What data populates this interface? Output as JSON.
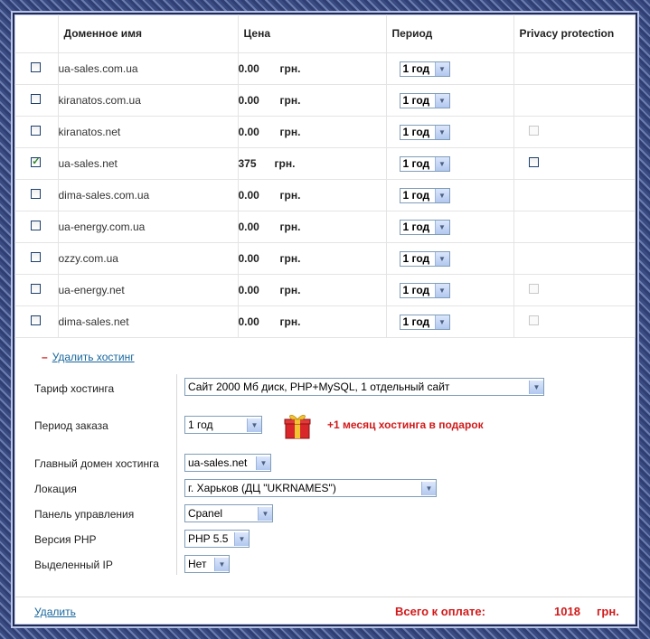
{
  "table": {
    "headers": {
      "domain": "Доменное имя",
      "price": "Цена",
      "period": "Период",
      "privacy": "Privacy protection"
    },
    "rows": [
      {
        "checked": false,
        "domain": "ua-sales.com.ua",
        "price": "0.00",
        "currency": "грн.",
        "period": "1 год",
        "privacy": "none"
      },
      {
        "checked": false,
        "domain": "kiranatos.com.ua",
        "price": "0.00",
        "currency": "грн.",
        "period": "1 год",
        "privacy": "none"
      },
      {
        "checked": false,
        "domain": "kiranatos.net",
        "price": "0.00",
        "currency": "грн.",
        "period": "1 год",
        "privacy": "disabled"
      },
      {
        "checked": true,
        "domain": "ua-sales.net",
        "price": "375",
        "currency": "грн.",
        "period": "1 год",
        "privacy": "enabled"
      },
      {
        "checked": false,
        "domain": "dima-sales.com.ua",
        "price": "0.00",
        "currency": "грн.",
        "period": "1 год",
        "privacy": "none"
      },
      {
        "checked": false,
        "domain": "ua-energy.com.ua",
        "price": "0.00",
        "currency": "грн.",
        "period": "1 год",
        "privacy": "none"
      },
      {
        "checked": false,
        "domain": "ozzy.com.ua",
        "price": "0.00",
        "currency": "грн.",
        "period": "1 год",
        "privacy": "none"
      },
      {
        "checked": false,
        "domain": "ua-energy.net",
        "price": "0.00",
        "currency": "грн.",
        "period": "1 год",
        "privacy": "disabled"
      },
      {
        "checked": false,
        "domain": "dima-sales.net",
        "price": "0.00",
        "currency": "грн.",
        "period": "1 год",
        "privacy": "disabled"
      }
    ]
  },
  "hosting": {
    "remove_label": "Удалить хостинг",
    "tariff": {
      "label": "Тариф хостинга",
      "value": "Сайт 2000 Мб диск, PHP+MySQL, 1 отдельный сайт"
    },
    "order_period": {
      "label": "Период заказа",
      "value": "1 год"
    },
    "gift_text": "+1 месяц хостинга в подарок",
    "main_domain": {
      "label": "Главный домен хостинга",
      "value": "ua-sales.net"
    },
    "location": {
      "label": "Локация",
      "value": "г. Харьков (ДЦ \"UKRNAMES\")"
    },
    "panel": {
      "label": "Панель управления",
      "value": "Cpanel"
    },
    "php": {
      "label": "Версия PHP",
      "value": "PHP 5.5"
    },
    "ip": {
      "label": "Выделенный IP",
      "value": "Нет"
    }
  },
  "footer": {
    "delete_label": "Удалить",
    "total_label": "Всего к оплате:",
    "total_value": "1018",
    "total_currency": "грн."
  },
  "colors": {
    "accent_red": "#d21a1a",
    "link_blue": "#17669c",
    "frame_blue": "#3a4b82"
  }
}
